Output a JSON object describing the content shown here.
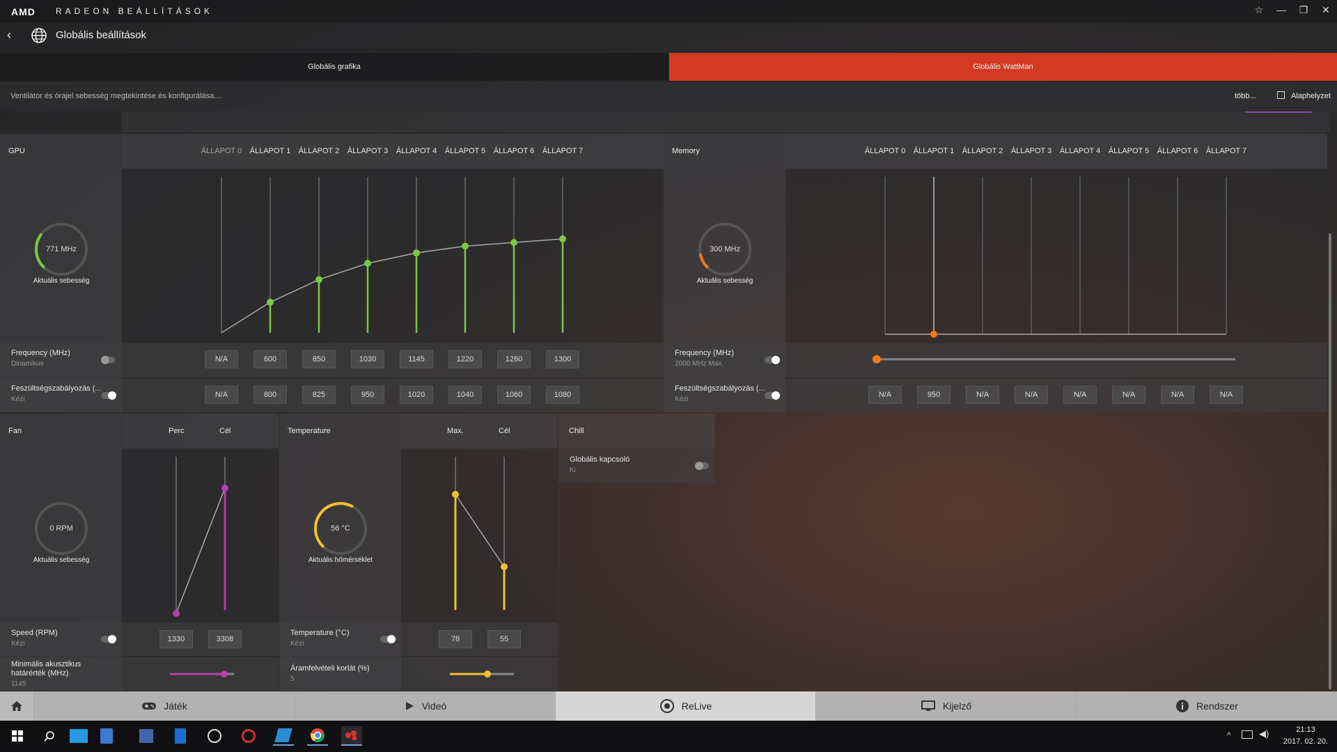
{
  "titlebar": {
    "brand": "AMD",
    "app_title": "RADEON BEÁLLÍTÁSOK"
  },
  "header": {
    "title": "Globális beállítások"
  },
  "tabs": [
    {
      "label": "Globális grafika",
      "active": false
    },
    {
      "label": "Globális WattMan",
      "active": true
    }
  ],
  "subheader": {
    "description": "Ventilátor és órajel sebesség megtekintése és konfigurálása....",
    "more": "több...",
    "reset": "Alaphelyzet"
  },
  "gpu": {
    "title": "GPU",
    "states": [
      "ÁLLAPOT 0",
      "ÁLLAPOT 1",
      "ÁLLAPOT 2",
      "ÁLLAPOT 3",
      "ÁLLAPOT 4",
      "ÁLLAPOT 5",
      "ÁLLAPOT 6",
      "ÁLLAPOT 7"
    ],
    "gauge_value": "771 MHz",
    "gauge_label": "Aktuális sebesség",
    "gauge_level": 0.3,
    "freq_label": "Frequency (MHz)",
    "freq_sub": "Dinamikus",
    "freq_values": [
      "N/A",
      "600",
      "850",
      "1030",
      "1145",
      "1220",
      "1260",
      "1300"
    ],
    "volt_label": "Feszültségszabályozás (...",
    "volt_sub": "Kézi",
    "volt_values": [
      "N/A",
      "800",
      "825",
      "950",
      "1020",
      "1040",
      "1060",
      "1080"
    ],
    "accent": "#7ac943"
  },
  "memory": {
    "title": "Memory",
    "states": [
      "ÁLLAPOT 0",
      "ÁLLAPOT 1",
      "ÁLLAPOT 2",
      "ÁLLAPOT 3",
      "ÁLLAPOT 4",
      "ÁLLAPOT 5",
      "ÁLLAPOT 6",
      "ÁLLAPOT 7"
    ],
    "gauge_value": "300 MHz",
    "gauge_label": "Aktuális sebesség",
    "gauge_level": 0.12,
    "freq_label": "Frequency (MHz)",
    "freq_sub": "2000 MHz Max.",
    "volt_label": "Feszültségszabályozás (...",
    "volt_sub": "Kézi",
    "volt_values": [
      "N/A",
      "950",
      "N/A",
      "N/A",
      "N/A",
      "N/A",
      "N/A",
      "N/A"
    ],
    "accent": "#f07a1a"
  },
  "fan": {
    "title": "Fan",
    "col_min": "Perc",
    "col_target": "Cél",
    "gauge_value": "0 RPM",
    "gauge_label": "Aktuális sebesség",
    "speed_label": "Speed (RPM)",
    "speed_sub": "Kézi",
    "speed_values": [
      "1330",
      "3308"
    ],
    "acoustic_label": "Minimális akusztikus határérték (MHz)",
    "acoustic_value": "1145",
    "accent": "#b83fa8"
  },
  "temperature": {
    "title": "Temperature",
    "col_max": "Max.",
    "col_target": "Cél",
    "gauge_value": "56 °C",
    "gauge_label": "Aktuális hőmérséklet",
    "gauge_level": 0.6,
    "temp_label": "Temperature (°C)",
    "temp_sub": "Kézi",
    "temp_values": [
      "78",
      "55"
    ],
    "power_label": "Áramfelvételi korlát (%)",
    "power_value": "5",
    "accent": "#f2c12e"
  },
  "chill": {
    "title": "Chill",
    "toggle_label": "Globális kapcsoló",
    "toggle_sub": "Ki"
  },
  "bottom_nav": [
    {
      "label": "Játék",
      "icon": "gamepad-icon"
    },
    {
      "label": "Videó",
      "icon": "play-icon"
    },
    {
      "label": "ReLive",
      "icon": "relive-icon"
    },
    {
      "label": "Kijelző",
      "icon": "monitor-icon"
    },
    {
      "label": "Rendszer",
      "icon": "info-icon"
    }
  ],
  "taskbar": {
    "time": "21:13",
    "date": "2017. 02. 20."
  }
}
